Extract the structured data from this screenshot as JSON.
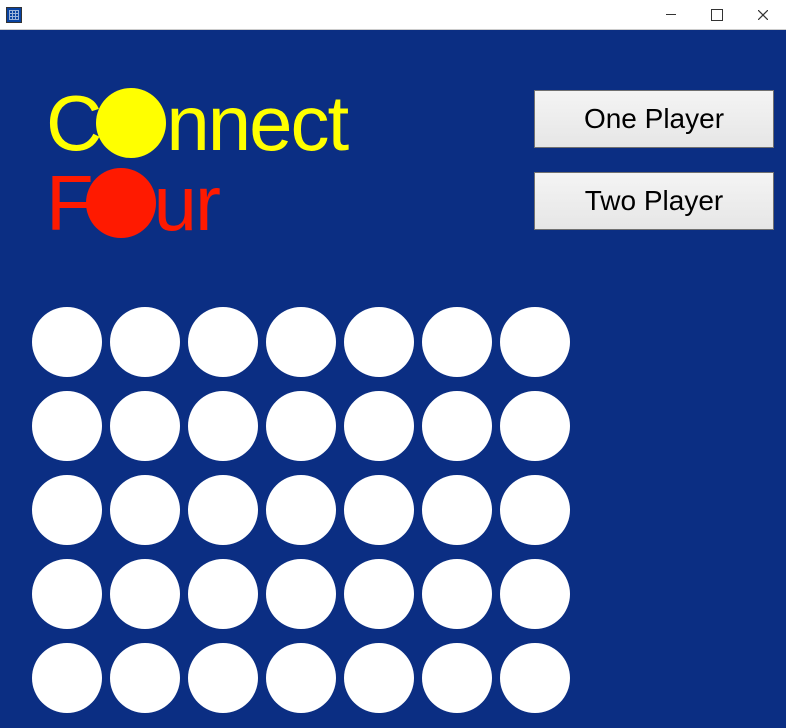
{
  "window": {
    "title": ""
  },
  "logo": {
    "line1_pre": "C",
    "line1_post": "nnect",
    "line2_pre": "F",
    "line2_post": "ur"
  },
  "buttons": {
    "one_player": "One Player",
    "two_player": "Two Player"
  },
  "board": {
    "columns": 7,
    "rows": 5,
    "cells": [
      [
        0,
        0,
        0,
        0,
        0,
        0,
        0
      ],
      [
        0,
        0,
        0,
        0,
        0,
        0,
        0
      ],
      [
        0,
        0,
        0,
        0,
        0,
        0,
        0
      ],
      [
        0,
        0,
        0,
        0,
        0,
        0,
        0
      ],
      [
        0,
        0,
        0,
        0,
        0,
        0,
        0
      ]
    ]
  },
  "colors": {
    "board_bg": "#0b2e83",
    "empty_cell": "#ffffff",
    "player1": "#ffff00",
    "player2": "#ff1a00"
  }
}
